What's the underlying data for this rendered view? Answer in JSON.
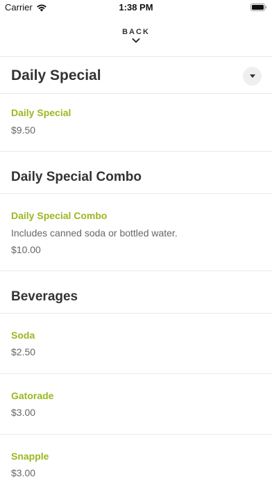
{
  "status_bar": {
    "carrier": "Carrier",
    "time": "1:38 PM"
  },
  "nav": {
    "back_label": "BACK"
  },
  "sections": [
    {
      "title": "Daily Special",
      "items": [
        {
          "name": "Daily Special",
          "price": "$9.50"
        }
      ]
    },
    {
      "title": "Daily Special Combo",
      "items": [
        {
          "name": "Daily Special Combo",
          "description": "Includes canned soda or bottled water.",
          "price": "$10.00"
        }
      ]
    },
    {
      "title": "Beverages",
      "items": [
        {
          "name": "Soda",
          "price": "$2.50"
        },
        {
          "name": "Gatorade",
          "price": "$3.00"
        },
        {
          "name": "Snapple",
          "price": "$3.00"
        }
      ]
    }
  ],
  "colors": {
    "accent": "#9ab81f",
    "text": "#333333",
    "muted": "#666666",
    "divider": "#e8e8e8"
  },
  "icons": {
    "wifi": "wifi-icon",
    "battery": "battery-icon",
    "back_chevron": "chevron-down-icon",
    "section_toggle": "caret-down-icon"
  }
}
